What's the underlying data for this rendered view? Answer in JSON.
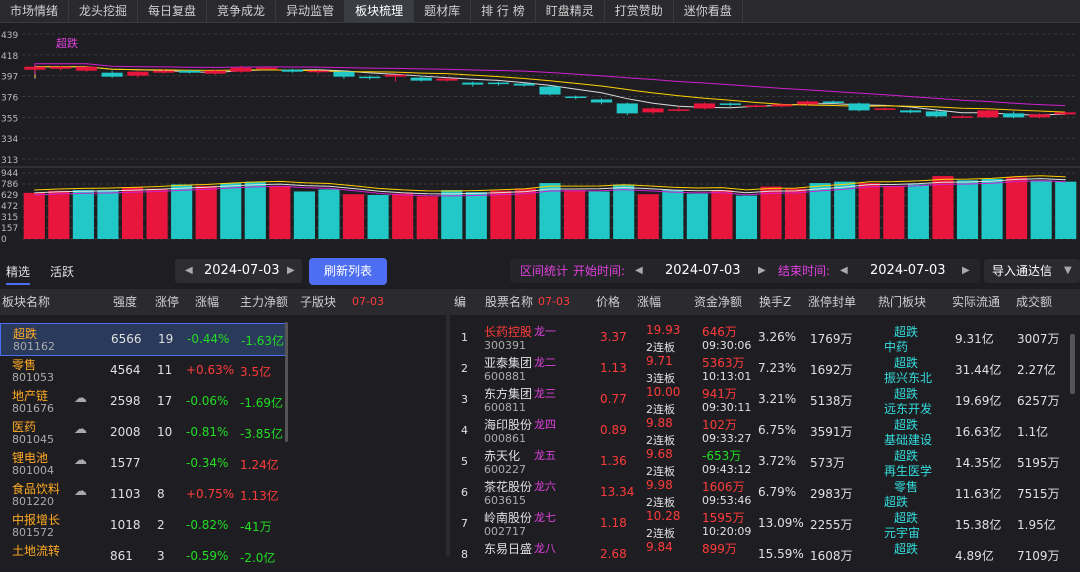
{
  "tabs": [
    "市场情绪",
    "龙头挖掘",
    "每日复盘",
    "竞争成龙",
    "异动监管",
    "板块梳理",
    "题材库",
    "排 行 榜",
    "盯盘精灵",
    "打赏赞助",
    "迷你看盘"
  ],
  "active_tab": 5,
  "chart": {
    "series_label": "超跌",
    "price_axis": [
      "439",
      "418",
      "397",
      "376",
      "355",
      "334",
      "313"
    ],
    "vol_axis": [
      "944",
      "786",
      "629",
      "472",
      "315",
      "157",
      "0"
    ]
  },
  "chart_data": {
    "type": "candlestick",
    "series_label": "超跌",
    "ylim": [
      313,
      439
    ],
    "candles": [
      {
        "o": 403,
        "c": 406,
        "h": 407,
        "l": 401
      },
      {
        "o": 404,
        "c": 406,
        "h": 407,
        "l": 402
      },
      {
        "o": 402,
        "c": 406,
        "h": 407,
        "l": 401
      },
      {
        "o": 400,
        "c": 396,
        "h": 402,
        "l": 395
      },
      {
        "o": 397,
        "c": 401,
        "h": 402,
        "l": 395
      },
      {
        "o": 400,
        "c": 402,
        "h": 403,
        "l": 399
      },
      {
        "o": 402,
        "c": 400,
        "h": 403,
        "l": 399
      },
      {
        "o": 399,
        "c": 402,
        "h": 403,
        "l": 398
      },
      {
        "o": 401,
        "c": 405,
        "h": 407,
        "l": 400
      },
      {
        "o": 404,
        "c": 405,
        "h": 406,
        "l": 403
      },
      {
        "o": 403,
        "c": 401,
        "h": 404,
        "l": 400
      },
      {
        "o": 401,
        "c": 402,
        "h": 403,
        "l": 399
      },
      {
        "o": 401,
        "c": 396,
        "h": 402,
        "l": 394
      },
      {
        "o": 396,
        "c": 395,
        "h": 397,
        "l": 393
      },
      {
        "o": 396,
        "c": 398,
        "h": 398,
        "l": 391
      },
      {
        "o": 395,
        "c": 392,
        "h": 397,
        "l": 391
      },
      {
        "o": 392,
        "c": 394,
        "h": 395,
        "l": 391
      },
      {
        "o": 390,
        "c": 388,
        "h": 391,
        "l": 386
      },
      {
        "o": 390,
        "c": 389,
        "h": 391,
        "l": 387
      },
      {
        "o": 389,
        "c": 387,
        "h": 390,
        "l": 386
      },
      {
        "o": 386,
        "c": 378,
        "h": 387,
        "l": 377
      },
      {
        "o": 376,
        "c": 375,
        "h": 377,
        "l": 373
      },
      {
        "o": 373,
        "c": 370,
        "h": 374,
        "l": 368
      },
      {
        "o": 369,
        "c": 359,
        "h": 370,
        "l": 357
      },
      {
        "o": 360,
        "c": 364,
        "h": 365,
        "l": 358
      },
      {
        "o": 362,
        "c": 363,
        "h": 366,
        "l": 361
      },
      {
        "o": 364,
        "c": 369,
        "h": 370,
        "l": 363
      },
      {
        "o": 369,
        "c": 368,
        "h": 370,
        "l": 366
      },
      {
        "o": 366,
        "c": 367,
        "h": 368,
        "l": 365
      },
      {
        "o": 366,
        "c": 368,
        "h": 369,
        "l": 365
      },
      {
        "o": 368,
        "c": 371,
        "h": 372,
        "l": 367
      },
      {
        "o": 371,
        "c": 370,
        "h": 372,
        "l": 369
      },
      {
        "o": 369,
        "c": 362,
        "h": 370,
        "l": 361
      },
      {
        "o": 363,
        "c": 364,
        "h": 365,
        "l": 362
      },
      {
        "o": 362,
        "c": 360,
        "h": 363,
        "l": 359
      },
      {
        "o": 361,
        "c": 356,
        "h": 362,
        "l": 355
      },
      {
        "o": 355,
        "c": 356,
        "h": 357,
        "l": 354
      },
      {
        "o": 355,
        "c": 362,
        "h": 363,
        "l": 354
      },
      {
        "o": 359,
        "c": 355,
        "h": 361,
        "l": 354
      },
      {
        "o": 355,
        "c": 358,
        "h": 359,
        "l": 354
      },
      {
        "o": 358,
        "c": 360,
        "h": 361,
        "l": 357
      }
    ],
    "volumes": [
      660,
      690,
      700,
      700,
      740,
      720,
      780,
      760,
      800,
      820,
      760,
      680,
      710,
      640,
      630,
      650,
      610,
      700,
      670,
      690,
      720,
      800,
      700,
      680,
      780,
      640,
      700,
      650,
      700,
      620,
      750,
      720,
      800,
      820,
      800,
      760,
      780,
      900,
      840,
      860,
      880,
      840,
      820
    ]
  },
  "controls": {
    "tab_select": "精选",
    "tab_active": "活跃",
    "date1": "2024-07-03",
    "refresh": "刷新列表",
    "range_label": "区间统计",
    "start_label": "开始时间:",
    "date2": "2024-07-03",
    "end_label": "结束时间:",
    "date3": "2024-07-03",
    "import": "导入通达信"
  },
  "left_header": {
    "name": "板块名称",
    "strength": "强度",
    "limit": "涨停",
    "change": "涨幅",
    "flow": "主力净额",
    "sub": "子版块",
    "date": "07-03"
  },
  "sectors": [
    {
      "name": "超跌",
      "code": "801162",
      "strength": "6566",
      "limit": "19",
      "change": "-0.44%",
      "flow": "-1.63亿",
      "cloud": false
    },
    {
      "name": "零售",
      "code": "801053",
      "strength": "4564",
      "limit": "11",
      "change": "+0.63%",
      "flow": "3.5亿",
      "cloud": false
    },
    {
      "name": "地产链",
      "code": "801676",
      "strength": "2598",
      "limit": "17",
      "change": "-0.06%",
      "flow": "-1.69亿",
      "cloud": true
    },
    {
      "name": "医药",
      "code": "801045",
      "strength": "2008",
      "limit": "10",
      "change": "-0.81%",
      "flow": "-3.85亿",
      "cloud": true
    },
    {
      "name": "锂电池",
      "code": "801004",
      "strength": "1577",
      "limit": "",
      "change": "-0.34%",
      "flow": "1.24亿",
      "cloud": true
    },
    {
      "name": "食品饮料",
      "code": "801220",
      "strength": "1103",
      "limit": "8",
      "change": "+0.75%",
      "flow": "1.13亿",
      "cloud": true
    },
    {
      "name": "中报增长",
      "code": "801572",
      "strength": "1018",
      "limit": "2",
      "change": "-0.82%",
      "flow": "-41万",
      "cloud": false
    },
    {
      "name": "土地流转",
      "code": "",
      "strength": "861",
      "limit": "3",
      "change": "-0.59%",
      "flow": "-2.0亿",
      "cloud": false
    }
  ],
  "right_header": {
    "idx": "编",
    "name": "股票名称",
    "date": "07-03",
    "price": "价格",
    "change": "涨幅",
    "flow": "资金净额",
    "turnover": "换手Z",
    "seal": "涨停封单",
    "hot": "热门板块",
    "circ": "实际流通",
    "amount": "成交额"
  },
  "stocks": [
    {
      "idx": "1",
      "name": "长药控股",
      "code": "300391",
      "rank": "龙一",
      "price": "3.37",
      "change": "19.93",
      "boards": "2连板",
      "flow": "646万",
      "time": "09:30:06",
      "turnover": "3.26%",
      "seal": "1769万",
      "hot1": "超跌",
      "hot2": "中药",
      "circ": "9.31亿",
      "amount": "3007万",
      "name_color": "red",
      "flow_color": "red"
    },
    {
      "idx": "2",
      "name": "亚泰集团",
      "code": "600881",
      "rank": "龙二",
      "price": "1.13",
      "change": "9.71",
      "boards": "3连板",
      "flow": "5363万",
      "time": "10:13:01",
      "turnover": "7.23%",
      "seal": "1692万",
      "hot1": "超跌",
      "hot2": "振兴东北",
      "circ": "31.44亿",
      "amount": "2.27亿",
      "name_color": "white",
      "flow_color": "red"
    },
    {
      "idx": "3",
      "name": "东方集团",
      "code": "600811",
      "rank": "龙三",
      "price": "0.77",
      "change": "10.00",
      "boards": "2连板",
      "flow": "941万",
      "time": "09:30:11",
      "turnover": "3.21%",
      "seal": "5138万",
      "hot1": "超跌",
      "hot2": "远东开发",
      "circ": "19.69亿",
      "amount": "6257万",
      "name_color": "white",
      "flow_color": "red"
    },
    {
      "idx": "4",
      "name": "海印股份",
      "code": "000861",
      "rank": "龙四",
      "price": "0.89",
      "change": "9.88",
      "boards": "2连板",
      "flow": "102万",
      "time": "09:33:27",
      "turnover": "6.75%",
      "seal": "3591万",
      "hot1": "超跌",
      "hot2": "基础建设",
      "circ": "16.63亿",
      "amount": "1.1亿",
      "name_color": "white",
      "flow_color": "red"
    },
    {
      "idx": "5",
      "name": "赤天化",
      "code": "600227",
      "rank": "龙五",
      "price": "1.36",
      "change": "9.68",
      "boards": "2连板",
      "flow": "-653万",
      "time": "09:43:12",
      "turnover": "3.72%",
      "seal": "573万",
      "hot1": "超跌",
      "hot2": "再生医学",
      "circ": "14.35亿",
      "amount": "5195万",
      "name_color": "white",
      "flow_color": "green"
    },
    {
      "idx": "6",
      "name": "茶花股份",
      "code": "603615",
      "rank": "龙六",
      "price": "13.34",
      "change": "9.98",
      "boards": "2连板",
      "flow": "1606万",
      "time": "09:53:46",
      "turnover": "6.79%",
      "seal": "2983万",
      "hot1": "零售",
      "hot2": "超跌",
      "circ": "11.63亿",
      "amount": "7515万",
      "name_color": "white",
      "flow_color": "red"
    },
    {
      "idx": "7",
      "name": "岭南股份",
      "code": "002717",
      "rank": "龙七",
      "price": "1.18",
      "change": "10.28",
      "boards": "2连板",
      "flow": "1595万",
      "time": "10:20:09",
      "turnover": "13.09%",
      "seal": "2255万",
      "hot1": "超跌",
      "hot2": "元宇宙",
      "circ": "15.38亿",
      "amount": "1.95亿",
      "name_color": "white",
      "flow_color": "red"
    },
    {
      "idx": "8",
      "name": "东易日盛",
      "code": "",
      "rank": "龙八",
      "price": "2.68",
      "change": "9.84",
      "boards": "",
      "flow": "899万",
      "time": "",
      "turnover": "15.59%",
      "seal": "1608万",
      "hot1": "超跌",
      "hot2": "",
      "circ": "4.89亿",
      "amount": "7109万",
      "name_color": "white",
      "flow_color": "red"
    }
  ]
}
